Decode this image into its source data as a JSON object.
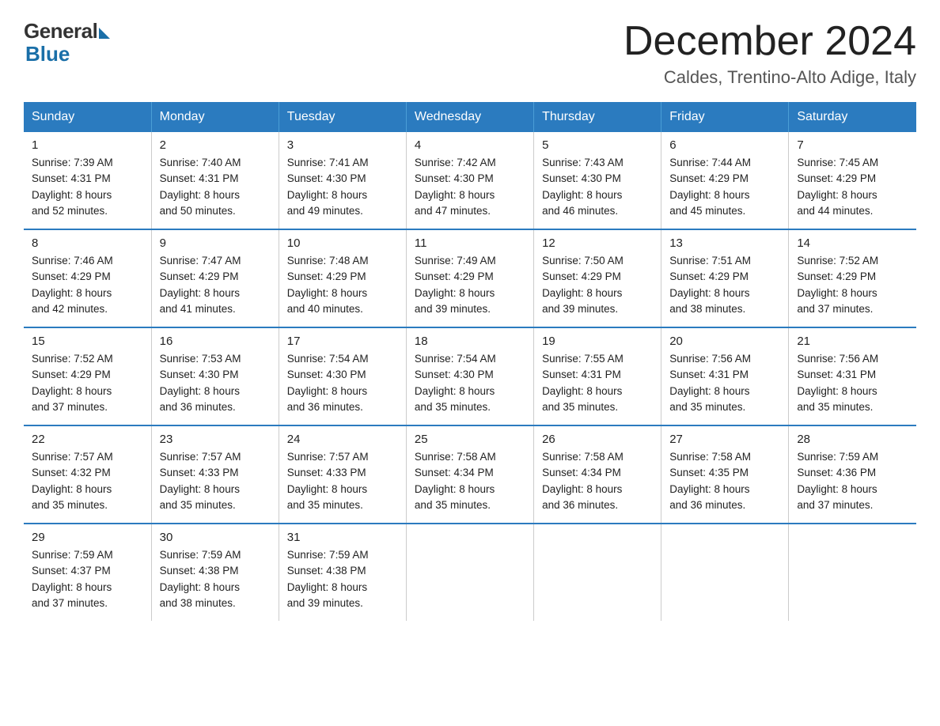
{
  "logo": {
    "general": "General",
    "blue": "Blue"
  },
  "title": "December 2024",
  "location": "Caldes, Trentino-Alto Adige, Italy",
  "days_of_week": [
    "Sunday",
    "Monday",
    "Tuesday",
    "Wednesday",
    "Thursday",
    "Friday",
    "Saturday"
  ],
  "weeks": [
    [
      {
        "day": "1",
        "sunrise": "7:39 AM",
        "sunset": "4:31 PM",
        "daylight": "8 hours and 52 minutes."
      },
      {
        "day": "2",
        "sunrise": "7:40 AM",
        "sunset": "4:31 PM",
        "daylight": "8 hours and 50 minutes."
      },
      {
        "day": "3",
        "sunrise": "7:41 AM",
        "sunset": "4:30 PM",
        "daylight": "8 hours and 49 minutes."
      },
      {
        "day": "4",
        "sunrise": "7:42 AM",
        "sunset": "4:30 PM",
        "daylight": "8 hours and 47 minutes."
      },
      {
        "day": "5",
        "sunrise": "7:43 AM",
        "sunset": "4:30 PM",
        "daylight": "8 hours and 46 minutes."
      },
      {
        "day": "6",
        "sunrise": "7:44 AM",
        "sunset": "4:29 PM",
        "daylight": "8 hours and 45 minutes."
      },
      {
        "day": "7",
        "sunrise": "7:45 AM",
        "sunset": "4:29 PM",
        "daylight": "8 hours and 44 minutes."
      }
    ],
    [
      {
        "day": "8",
        "sunrise": "7:46 AM",
        "sunset": "4:29 PM",
        "daylight": "8 hours and 42 minutes."
      },
      {
        "day": "9",
        "sunrise": "7:47 AM",
        "sunset": "4:29 PM",
        "daylight": "8 hours and 41 minutes."
      },
      {
        "day": "10",
        "sunrise": "7:48 AM",
        "sunset": "4:29 PM",
        "daylight": "8 hours and 40 minutes."
      },
      {
        "day": "11",
        "sunrise": "7:49 AM",
        "sunset": "4:29 PM",
        "daylight": "8 hours and 39 minutes."
      },
      {
        "day": "12",
        "sunrise": "7:50 AM",
        "sunset": "4:29 PM",
        "daylight": "8 hours and 39 minutes."
      },
      {
        "day": "13",
        "sunrise": "7:51 AM",
        "sunset": "4:29 PM",
        "daylight": "8 hours and 38 minutes."
      },
      {
        "day": "14",
        "sunrise": "7:52 AM",
        "sunset": "4:29 PM",
        "daylight": "8 hours and 37 minutes."
      }
    ],
    [
      {
        "day": "15",
        "sunrise": "7:52 AM",
        "sunset": "4:29 PM",
        "daylight": "8 hours and 37 minutes."
      },
      {
        "day": "16",
        "sunrise": "7:53 AM",
        "sunset": "4:30 PM",
        "daylight": "8 hours and 36 minutes."
      },
      {
        "day": "17",
        "sunrise": "7:54 AM",
        "sunset": "4:30 PM",
        "daylight": "8 hours and 36 minutes."
      },
      {
        "day": "18",
        "sunrise": "7:54 AM",
        "sunset": "4:30 PM",
        "daylight": "8 hours and 35 minutes."
      },
      {
        "day": "19",
        "sunrise": "7:55 AM",
        "sunset": "4:31 PM",
        "daylight": "8 hours and 35 minutes."
      },
      {
        "day": "20",
        "sunrise": "7:56 AM",
        "sunset": "4:31 PM",
        "daylight": "8 hours and 35 minutes."
      },
      {
        "day": "21",
        "sunrise": "7:56 AM",
        "sunset": "4:31 PM",
        "daylight": "8 hours and 35 minutes."
      }
    ],
    [
      {
        "day": "22",
        "sunrise": "7:57 AM",
        "sunset": "4:32 PM",
        "daylight": "8 hours and 35 minutes."
      },
      {
        "day": "23",
        "sunrise": "7:57 AM",
        "sunset": "4:33 PM",
        "daylight": "8 hours and 35 minutes."
      },
      {
        "day": "24",
        "sunrise": "7:57 AM",
        "sunset": "4:33 PM",
        "daylight": "8 hours and 35 minutes."
      },
      {
        "day": "25",
        "sunrise": "7:58 AM",
        "sunset": "4:34 PM",
        "daylight": "8 hours and 35 minutes."
      },
      {
        "day": "26",
        "sunrise": "7:58 AM",
        "sunset": "4:34 PM",
        "daylight": "8 hours and 36 minutes."
      },
      {
        "day": "27",
        "sunrise": "7:58 AM",
        "sunset": "4:35 PM",
        "daylight": "8 hours and 36 minutes."
      },
      {
        "day": "28",
        "sunrise": "7:59 AM",
        "sunset": "4:36 PM",
        "daylight": "8 hours and 37 minutes."
      }
    ],
    [
      {
        "day": "29",
        "sunrise": "7:59 AM",
        "sunset": "4:37 PM",
        "daylight": "8 hours and 37 minutes."
      },
      {
        "day": "30",
        "sunrise": "7:59 AM",
        "sunset": "4:38 PM",
        "daylight": "8 hours and 38 minutes."
      },
      {
        "day": "31",
        "sunrise": "7:59 AM",
        "sunset": "4:38 PM",
        "daylight": "8 hours and 39 minutes."
      },
      null,
      null,
      null,
      null
    ]
  ],
  "labels": {
    "sunrise": "Sunrise:",
    "sunset": "Sunset:",
    "daylight": "Daylight:"
  }
}
